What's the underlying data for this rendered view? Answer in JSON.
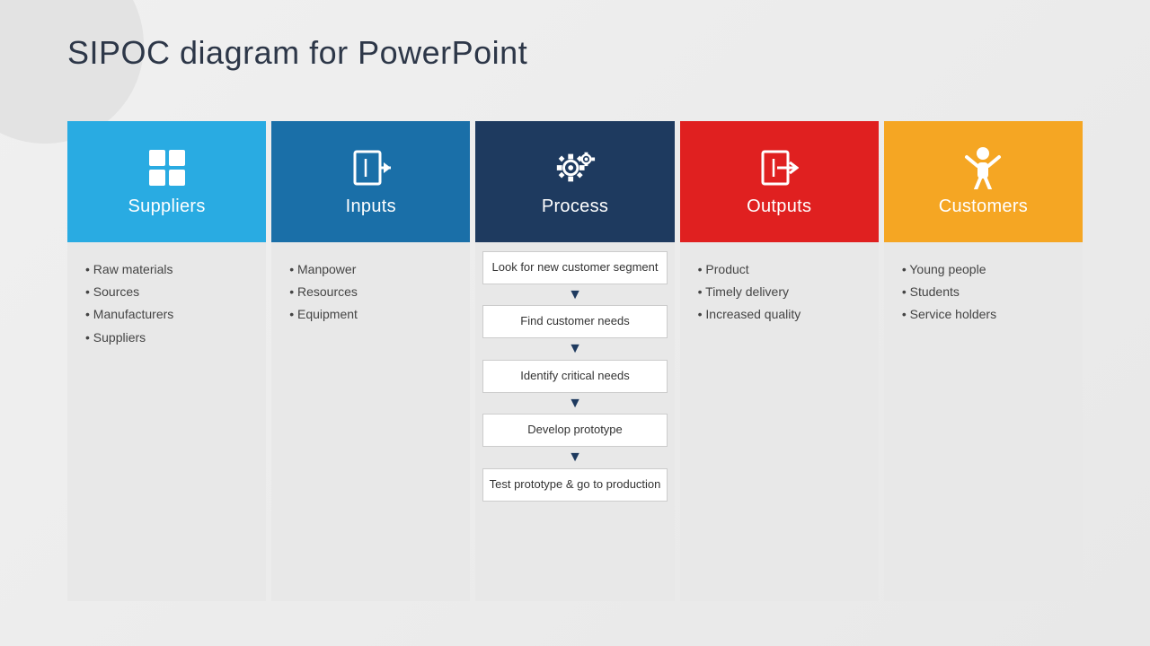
{
  "page": {
    "title": "SIPOC diagram for PowerPoint"
  },
  "columns": [
    {
      "id": "suppliers",
      "label": "Suppliers",
      "color": "#29abe2",
      "icon_type": "grid",
      "bullets": [
        "Raw materials",
        "Sources",
        "Manufacturers",
        "Suppliers"
      ]
    },
    {
      "id": "inputs",
      "label": "Inputs",
      "color": "#1a6fa8",
      "icon_type": "arrow-in",
      "bullets": [
        "Manpower",
        "Resources",
        "Equipment"
      ]
    },
    {
      "id": "process",
      "label": "Process",
      "color": "#1e3a5f",
      "icon_type": "gears",
      "steps": [
        "Look for new customer segment",
        "Find customer needs",
        "Identify critical needs",
        "Develop prototype",
        "Test prototype & go to production"
      ]
    },
    {
      "id": "outputs",
      "label": "Outputs",
      "color": "#e02020",
      "icon_type": "arrow-out",
      "bullets": [
        "Product",
        "Timely delivery",
        "Increased quality"
      ]
    },
    {
      "id": "customers",
      "label": "Customers",
      "color": "#f5a623",
      "icon_type": "person",
      "bullets": [
        "Young people",
        "Students",
        "Service holders"
      ]
    }
  ],
  "labels": {
    "suppliers": "Suppliers",
    "inputs": "Inputs",
    "process": "Process",
    "outputs": "Outputs",
    "customers": "Customers"
  }
}
